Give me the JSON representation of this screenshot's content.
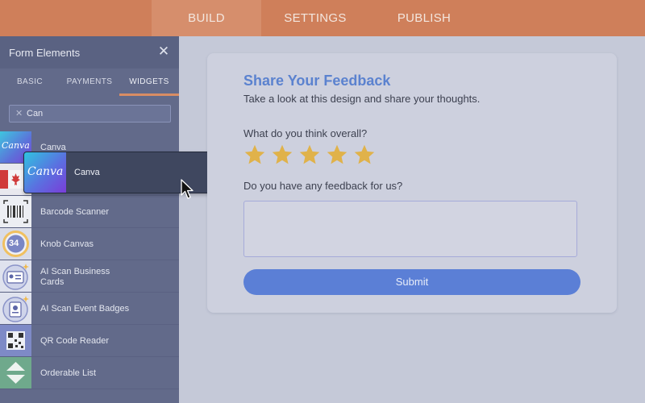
{
  "topbar": {
    "tabs": [
      {
        "label": "BUILD"
      },
      {
        "label": "SETTINGS"
      },
      {
        "label": "PUBLISH"
      }
    ],
    "active": "BUILD",
    "color": "#cf7f5a"
  },
  "sidebar": {
    "title": "Form Elements",
    "close_icon": "close-icon",
    "tabs": [
      {
        "label": "BASIC"
      },
      {
        "label": "PAYMENTS"
      },
      {
        "label": "WIDGETS"
      }
    ],
    "active_tab": "WIDGETS",
    "search": {
      "value": "Can"
    },
    "items": [
      {
        "label": "Canva",
        "icon": "canva-logo"
      },
      {
        "label": "Canada flag",
        "icon": "canada-flag-icon"
      },
      {
        "label": "Barcode Scanner",
        "icon": "barcode-icon"
      },
      {
        "label": "Knob Canvas",
        "icon": "knob-icon",
        "badge": "34"
      },
      {
        "label": "AI Scan Business Cards",
        "icon": "business-card-icon"
      },
      {
        "label": "AI Scan Event Badges",
        "icon": "badge-icon"
      },
      {
        "label": "QR Code Reader",
        "icon": "qr-code-icon"
      },
      {
        "label": "Orderable List",
        "icon": "sort-arrows-icon"
      }
    ],
    "canva_logo_text": "Canva"
  },
  "drag_ghost": {
    "label": "Canva",
    "logo_text": "Canva"
  },
  "form": {
    "title": "Share Your Feedback",
    "subtitle": "Take a look at this design and share your thoughts.",
    "question1": "What do you think overall?",
    "rating": {
      "stars": 5,
      "color": "#e0b24a"
    },
    "question2": "Do you have any feedback for us?",
    "submit_label": "Submit",
    "accent": "#5b82cf"
  }
}
